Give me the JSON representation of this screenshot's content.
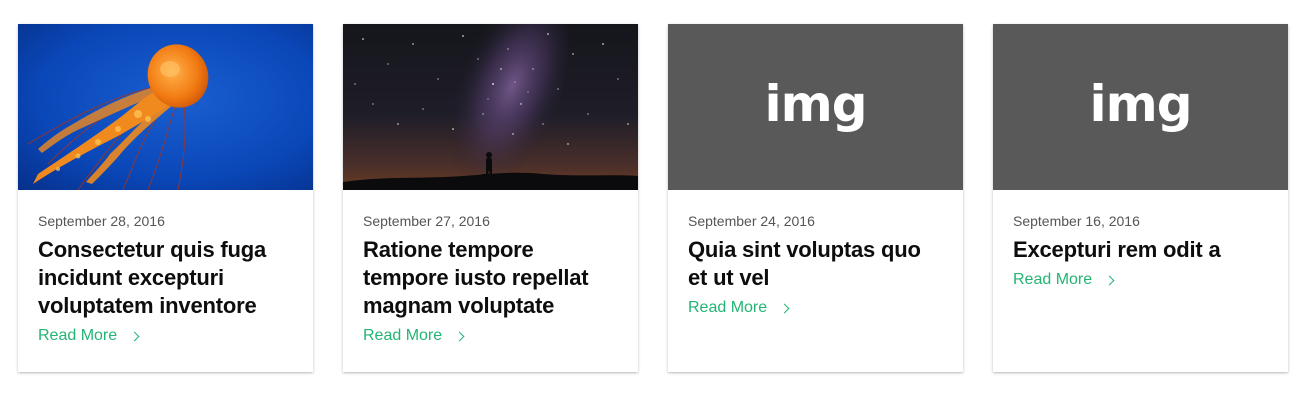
{
  "colors": {
    "accent": "#22b573",
    "placeholder_bg": "#595959",
    "date_text": "#555555",
    "title_text": "#0d0d0d"
  },
  "cards": [
    {
      "image": "jellyfish-photo",
      "date": "September 28, 2016",
      "title": "Consectetur quis fuga incidunt excepturi voluptatem inventore",
      "link": "Read More"
    },
    {
      "image": "milky-way-photo",
      "date": "September 27, 2016",
      "title": "Ratione tempore tempore iusto repellat magnam voluptate",
      "link": "Read More"
    },
    {
      "image": "img-placeholder",
      "placeholder_text": "img",
      "date": "September 24, 2016",
      "title": "Quia sint voluptas quo et ut vel",
      "link": "Read More"
    },
    {
      "image": "img-placeholder",
      "placeholder_text": "img",
      "date": "September 16, 2016",
      "title": "Excepturi rem odit a",
      "link": "Read More"
    }
  ]
}
